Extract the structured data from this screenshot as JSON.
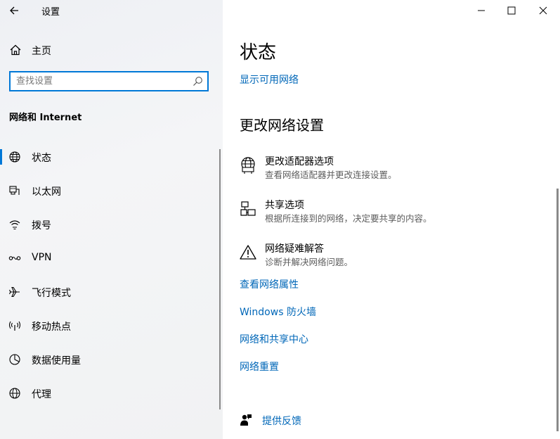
{
  "window": {
    "title": "设置",
    "controls": [
      "minimize-icon",
      "maximize-icon",
      "close-icon"
    ]
  },
  "sidebar": {
    "home_label": "主页",
    "search_placeholder": "查找设置",
    "section_title": "网络和 Internet",
    "items": [
      {
        "label": "状态",
        "icon": "globe-icon",
        "active": true
      },
      {
        "label": "以太网",
        "icon": "ethernet-icon"
      },
      {
        "label": "拨号",
        "icon": "dialup-icon"
      },
      {
        "label": "VPN",
        "icon": "vpn-icon"
      },
      {
        "label": "飞行模式",
        "icon": "airplane-icon"
      },
      {
        "label": "移动热点",
        "icon": "hotspot-icon"
      },
      {
        "label": "数据使用量",
        "icon": "data-usage-icon"
      },
      {
        "label": "代理",
        "icon": "proxy-globe-icon"
      }
    ]
  },
  "main": {
    "title": "状态",
    "show_networks_link": "显示可用网络",
    "change_settings_title": "更改网络设置",
    "options": [
      {
        "title": "更改适配器选项",
        "desc": "查看网络适配器并更改连接设置。",
        "icon": "adapter-globe-icon"
      },
      {
        "title": "共享选项",
        "desc": "根据所连接到的网络，决定要共享的内容。",
        "icon": "sharing-icon"
      },
      {
        "title": "网络疑难解答",
        "desc": "诊断并解决网络问题。",
        "icon": "warning-icon"
      }
    ],
    "links": [
      "查看网络属性",
      "Windows 防火墙",
      "网络和共享中心",
      "网络重置"
    ],
    "feedback_label": "提供反馈"
  },
  "colors": {
    "accent": "#0078d7",
    "link": "#0067b8"
  }
}
